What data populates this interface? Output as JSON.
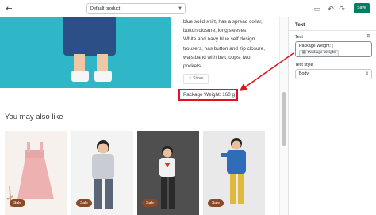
{
  "topbar": {
    "product_select": "Default product",
    "save_label": "Save",
    "icons": [
      "exit-icon",
      "desktop-icon",
      "undo-icon",
      "redo-icon",
      "chevron-down-icon"
    ]
  },
  "preview": {
    "description_lines": [
      "blue solid shirt, has a spread collar,",
      "button closure, long sleeves.",
      "White and navy blue self design",
      "trousers, has button and zip closure,",
      "waistband with belt loops, two",
      "pockets."
    ],
    "share_label": "Share",
    "package_weight": "Package Weight: 160 g",
    "related_title": "You may also like",
    "cards": [
      {
        "badge": "Sale"
      },
      {
        "badge": "Sale"
      },
      {
        "badge": "Sale"
      },
      {
        "badge": "Sale"
      }
    ]
  },
  "panel": {
    "title": "Text",
    "text_label": "Text",
    "text_value": "Package Weight: |",
    "dynamic_source_pill": "Package Weight",
    "text_style_label": "Text style",
    "text_style_value": "Body"
  },
  "colors": {
    "accent": "#008060",
    "highlight": "#e0141e",
    "sale_badge": "#8a4a25",
    "hero_bg": "#2fb7c7"
  }
}
